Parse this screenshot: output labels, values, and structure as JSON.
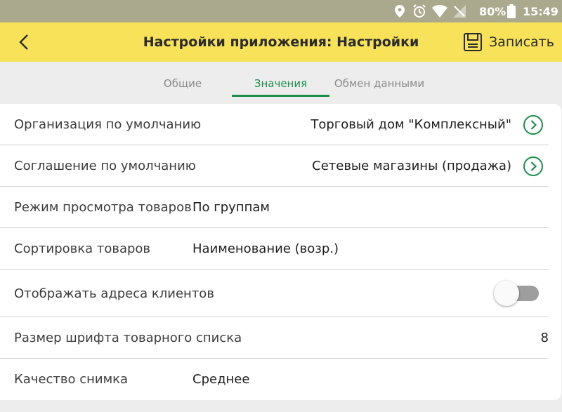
{
  "status_bar": {
    "icons": [
      "location-icon",
      "alarm-icon",
      "wifi-icon",
      "no-signal-icon",
      "battery-icon"
    ],
    "battery": "80%",
    "time": "15:49"
  },
  "toolbar": {
    "back_icon": "chevron-left-icon",
    "title": "Настройки приложения: Настройки",
    "save_icon": "floppy-disk-icon",
    "save_label": "Записать"
  },
  "tabs": [
    {
      "label": "Общие",
      "active": false
    },
    {
      "label": "Значения",
      "active": true
    },
    {
      "label": "Обмен данными",
      "active": false
    }
  ],
  "settings": [
    {
      "label": "Организация по умолчанию",
      "value": "Торговый дом \"Комплексный\"",
      "control": "chevron-right-circle-icon"
    },
    {
      "label": "Соглашение по умолчанию",
      "value": "Сетевые магазины (продажа)",
      "control": "chevron-right-circle-icon"
    },
    {
      "label": "Режим просмотра товаров",
      "value": "По группам"
    },
    {
      "label": "Сортировка товаров",
      "value": "Наименование (возр.)"
    },
    {
      "label": "Отображать адреса клиентов",
      "toggle_on": false
    },
    {
      "label": "Размер шрифта товарного списка",
      "value": "8"
    },
    {
      "label": "Качество снимка",
      "value": "Среднее"
    }
  ],
  "colors": {
    "status_bar": "#aaa98e",
    "toolbar": "#f8e25a",
    "accent": "#1c8f4b",
    "background": "#ededed"
  }
}
